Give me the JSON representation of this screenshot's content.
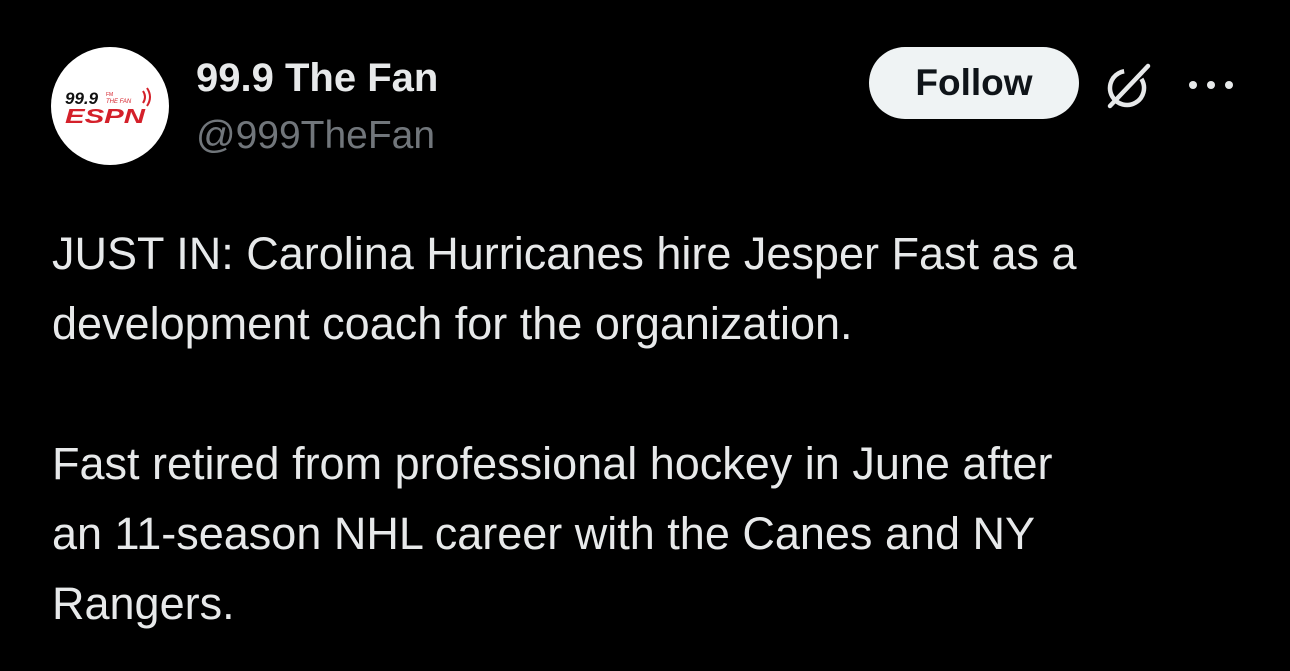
{
  "author": {
    "display_name": "99.9 The Fan",
    "handle": "@999TheFan",
    "avatar_icon": "999-the-fan-espn-logo",
    "avatar_logo_text": {
      "frequency": "99.9",
      "fm": "FM",
      "station": "THE FAN",
      "brand": "ESPN"
    }
  },
  "actions": {
    "follow_label": "Follow",
    "grok_icon": "grok-icon",
    "more_icon": "more-options-icon"
  },
  "tweet": {
    "paragraphs": [
      {
        "lines": [
          "JUST IN: Carolina Hurricanes hire Jesper Fast as a",
          "development coach for the organization."
        ]
      },
      {
        "lines": [
          "Fast retired from professional hockey in June after",
          "an 11-season NHL career with the Canes and NY",
          "Rangers."
        ]
      }
    ]
  },
  "colors": {
    "background": "#000000",
    "primary_text": "#e7e9ea",
    "secondary_text": "#71767b",
    "follow_button_bg": "#eff3f4",
    "follow_button_text": "#0f1419",
    "logo_red": "#d4202a"
  }
}
